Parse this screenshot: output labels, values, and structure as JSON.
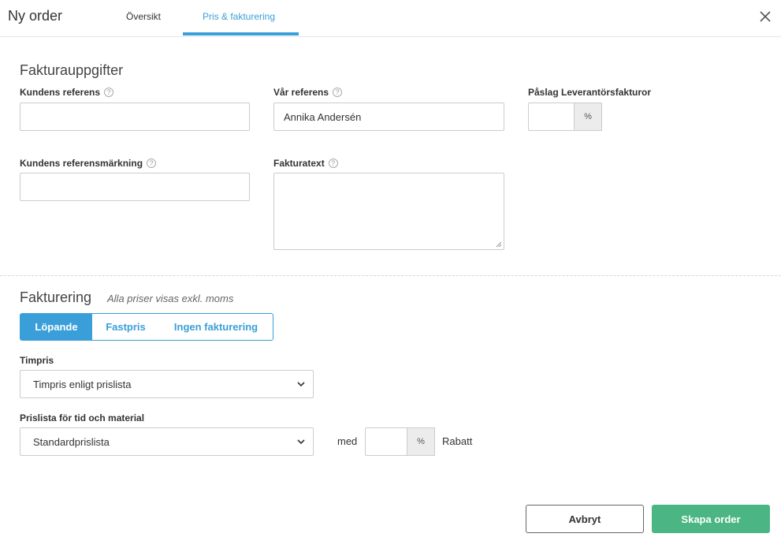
{
  "header": {
    "title": "Ny order",
    "tabs": [
      {
        "label": "Översikt",
        "active": false
      },
      {
        "label": "Pris & fakturering",
        "active": true
      }
    ],
    "close_icon": "close-icon",
    "accent_color": "#3a9fd8"
  },
  "invoice_details": {
    "title": "Fakturauppgifter",
    "customer_reference": {
      "label": "Kundens referens",
      "value": ""
    },
    "our_reference": {
      "label": "Vår referens",
      "value": "Annika  Andersén"
    },
    "supplier_markup": {
      "label": "Påslag Leverantörsfakturor",
      "value": "",
      "unit": "%"
    },
    "customer_reference_marking": {
      "label": "Kundens referensmärkning",
      "value": ""
    },
    "invoice_text": {
      "label": "Fakturatext",
      "value": ""
    }
  },
  "billing": {
    "title": "Fakturering",
    "note": "Alla priser visas exkl. moms",
    "modes": [
      {
        "label": "Löpande",
        "active": true
      },
      {
        "label": "Fastpris",
        "active": false
      },
      {
        "label": "Ingen fakturering",
        "active": false
      }
    ],
    "hourly_rate": {
      "label": "Timpris",
      "selected": "Timpris enligt prislista"
    },
    "price_list": {
      "label": "Prislista för tid och material",
      "selected": "Standardprislista"
    },
    "with_label": "med",
    "discount": {
      "value": "",
      "unit": "%",
      "label": "Rabatt"
    }
  },
  "footer": {
    "cancel_label": "Avbryt",
    "create_label": "Skapa order",
    "create_color": "#4bb583"
  }
}
